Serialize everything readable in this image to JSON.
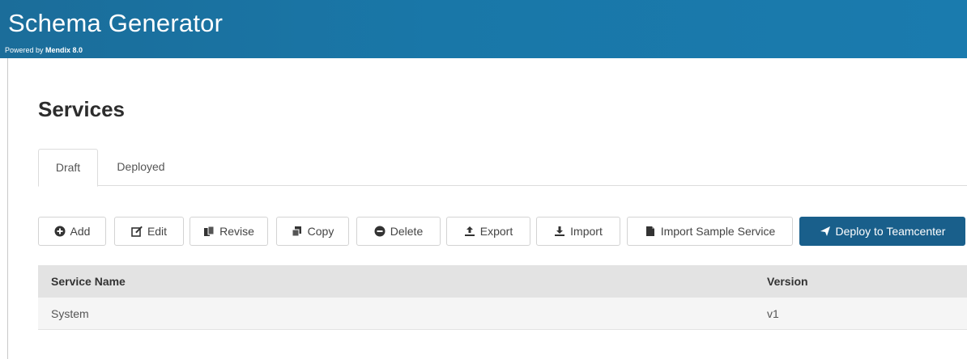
{
  "header": {
    "title": "Schema Generator",
    "powered_by_prefix": "Powered by",
    "powered_by_brand": "Mendix 8.0"
  },
  "page": {
    "title": "Services"
  },
  "tabs": [
    {
      "label": "Draft",
      "active": true
    },
    {
      "label": "Deployed",
      "active": false
    }
  ],
  "toolbar": {
    "add": "Add",
    "edit": "Edit",
    "revise": "Revise",
    "copy": "Copy",
    "delete": "Delete",
    "export": "Export",
    "import": "Import",
    "import_sample": "Import Sample Service",
    "deploy": "Deploy to Teamcenter"
  },
  "grid": {
    "columns": [
      "Service Name",
      "Version"
    ],
    "rows": [
      {
        "service_name": "System",
        "version": "v1"
      }
    ]
  },
  "colors": {
    "header": "#1a78ab",
    "primary_button": "#195f8b"
  },
  "icons": {
    "add": "plus-circle-icon",
    "edit": "edit-icon",
    "revise": "revise-icon",
    "copy": "copy-icon",
    "delete": "delete-circle-icon",
    "export": "export-icon",
    "import": "import-icon",
    "import_sample": "file-icon",
    "deploy": "send-icon"
  }
}
